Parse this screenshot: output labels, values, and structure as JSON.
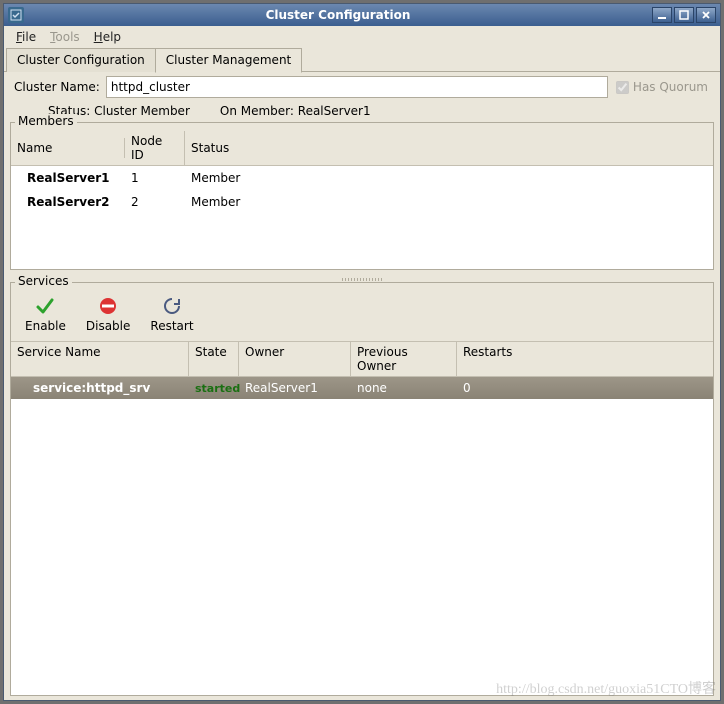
{
  "window": {
    "title": "Cluster Configuration"
  },
  "menubar": {
    "file": "File",
    "tools": "Tools",
    "help": "Help"
  },
  "tabs": {
    "config": "Cluster Configuration",
    "mgmt": "Cluster Management"
  },
  "cluster": {
    "name_label": "Cluster Name:",
    "name_value": "httpd_cluster",
    "has_quorum": "Has Quorum",
    "status_label": "Status:",
    "status_value": "Cluster Member",
    "on_member_label": "On Member:",
    "on_member_value": "RealServer1"
  },
  "members": {
    "title": "Members",
    "headers": {
      "name": "Name",
      "node_id": "Node ID",
      "status": "Status"
    },
    "rows": [
      {
        "name": "RealServer1",
        "node_id": "1",
        "status": "Member"
      },
      {
        "name": "RealServer2",
        "node_id": "2",
        "status": "Member"
      }
    ]
  },
  "services": {
    "title": "Services",
    "toolbar": {
      "enable": "Enable",
      "disable": "Disable",
      "restart": "Restart"
    },
    "headers": {
      "name": "Service Name",
      "state": "State",
      "owner": "Owner",
      "prev_owner": "Previous Owner",
      "restarts": "Restarts"
    },
    "rows": [
      {
        "name": "service:httpd_srv",
        "state": "started",
        "owner": "RealServer1",
        "prev_owner": "none",
        "restarts": "0"
      }
    ]
  },
  "watermark": "http://blog.csdn.net/guoxia51CTO博客"
}
